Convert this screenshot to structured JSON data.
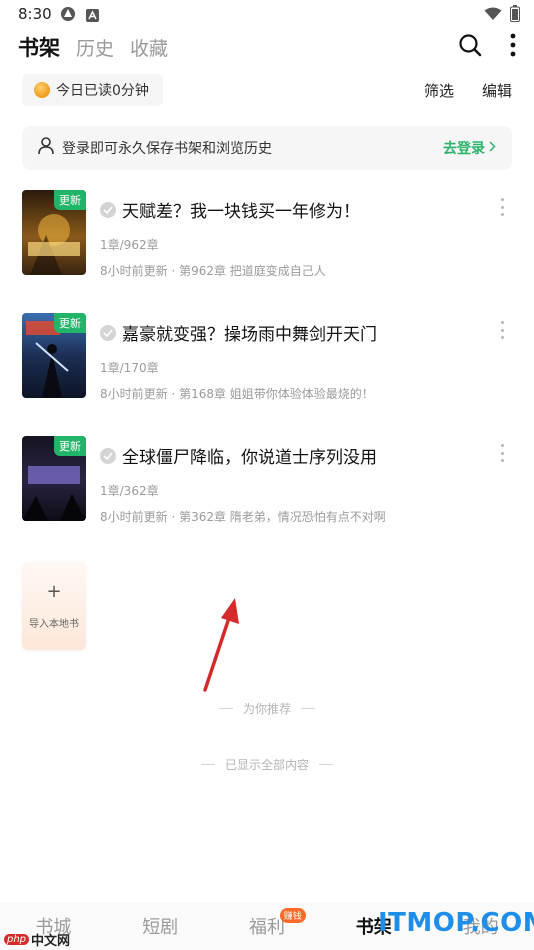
{
  "status_bar": {
    "time": "8:30"
  },
  "top_tabs": [
    {
      "label": "书架",
      "active": true
    },
    {
      "label": "历史",
      "active": false
    },
    {
      "label": "收藏",
      "active": false
    }
  ],
  "reading": {
    "today_label": "今日已读0分钟"
  },
  "toolbar": {
    "filter_label": "筛选",
    "edit_label": "编辑"
  },
  "login_banner": {
    "text": "登录即可永久保存书架和浏览历史",
    "link": "去登录"
  },
  "books": [
    {
      "badge": "更新",
      "title": "天赋差？我一块钱买一年修为！",
      "progress": "1章/962章",
      "update": "8小时前更新 · 第962章 把道庭变成自己人"
    },
    {
      "badge": "更新",
      "title": "嘉豪就变强？操场雨中舞剑开天门",
      "progress": "1章/170章",
      "update": "8小时前更新 · 第168章 姐姐带你体验体验最烧的！"
    },
    {
      "badge": "更新",
      "title": "全球僵尸降临，你说道士序列没用",
      "progress": "1章/362章",
      "update": "8小时前更新 · 第362章 隋老弟，情况恐怕有点不对啊"
    }
  ],
  "import_book": {
    "plus": "+",
    "label": "导入本地书"
  },
  "recommend_label": "为你推荐",
  "end_label": "已显示全部内容",
  "bottom_nav": [
    {
      "label": "书城",
      "active": false
    },
    {
      "label": "短剧",
      "active": false
    },
    {
      "label": "福利",
      "active": false,
      "badge": "赚钱"
    },
    {
      "label": "书架",
      "active": true
    },
    {
      "label": "我的",
      "active": false
    }
  ],
  "watermarks": {
    "right": "ITMOP.COM",
    "left_badge": "php",
    "left_text": "中文网"
  },
  "colors": {
    "accent_green": "#2db36b",
    "badge_green": "#22b56a",
    "earn_orange": "#ff6a2b"
  }
}
